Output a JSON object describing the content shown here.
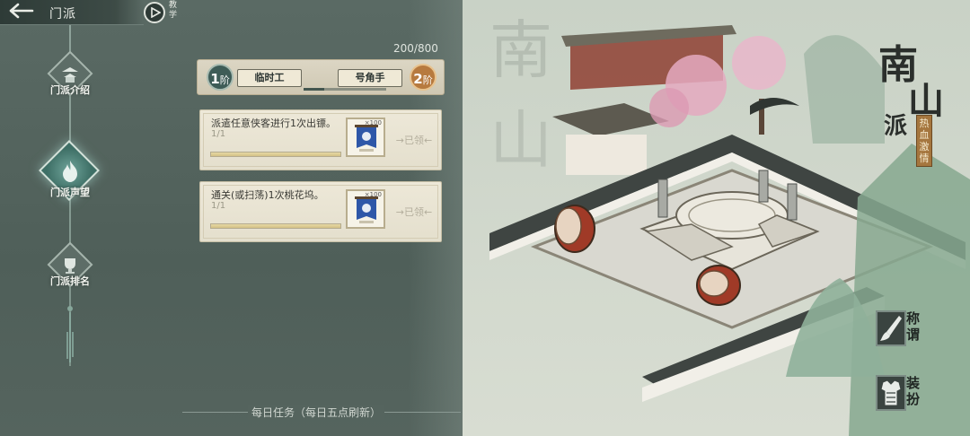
{
  "header": {
    "back_label": "🡐",
    "title": "门派",
    "tutorial_label": "教学"
  },
  "nav": {
    "items": [
      {
        "label": "门派介绍",
        "icon": "pagoda-icon"
      },
      {
        "label": "门派声望",
        "icon": "flame-icon",
        "active": true
      },
      {
        "label": "门派排名",
        "icon": "trophy-icon"
      }
    ]
  },
  "reputation": {
    "progress_text": "200/800",
    "progress_fraction": 0.25,
    "current_rank_num": "1",
    "current_rank_unit": "阶",
    "current_rank_name": "临时工",
    "next_rank_num": "2",
    "next_rank_unit": "阶",
    "next_rank_name": "号角手"
  },
  "tasks": [
    {
      "title": "派遣任意侠客进行1次出镖。",
      "count": "1/1",
      "progress": 1.0,
      "reward_qty": "×100",
      "status": "已领"
    },
    {
      "title": "通关(或扫荡)1次桃花坞。",
      "count": "1/1",
      "progress": 1.0,
      "reward_qty": "×100",
      "status": "已领"
    }
  ],
  "footer": {
    "text": "每日任务（每日五点刷新）"
  },
  "sect": {
    "char1": "南",
    "char2": "山",
    "char3": "派",
    "motto": "热血激情"
  },
  "side_buttons": [
    {
      "label": "称谓",
      "icon": "brush-icon"
    },
    {
      "label": "装扮",
      "icon": "armor-icon"
    }
  ],
  "colors": {
    "panel": "#55645e",
    "card": "#e9e4d3",
    "accent_current": "#3e5c57",
    "accent_next": "#b77a3f"
  }
}
